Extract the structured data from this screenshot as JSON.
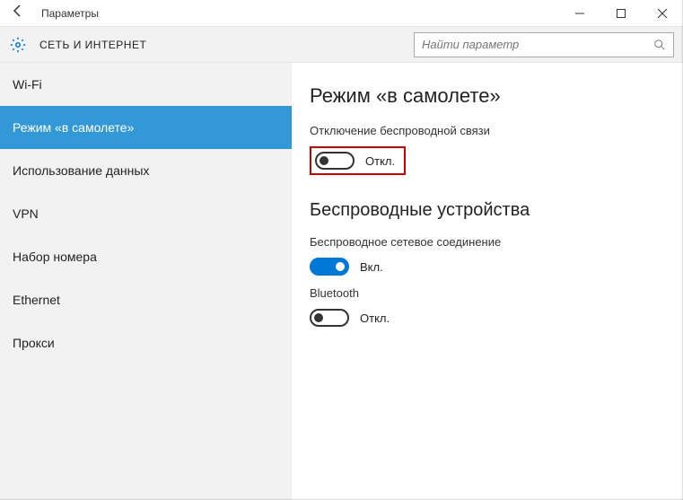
{
  "titlebar": {
    "title": "Параметры"
  },
  "header": {
    "title": "СЕТЬ И ИНТЕРНЕТ",
    "search_placeholder": "Найти параметр"
  },
  "sidebar": {
    "items": [
      {
        "label": "Wi-Fi"
      },
      {
        "label": "Режим «в самолете»"
      },
      {
        "label": "Использование данных"
      },
      {
        "label": "VPN"
      },
      {
        "label": "Набор номера"
      },
      {
        "label": "Ethernet"
      },
      {
        "label": "Прокси"
      }
    ],
    "active_index": 1
  },
  "main": {
    "h1": "Режим «в самолете»",
    "desc": "Отключение беспроводной связи",
    "airplane_toggle_label": "Откл.",
    "h2": "Беспроводные устройства",
    "wireless_label": "Беспроводное сетевое соединение",
    "wireless_toggle_label": "Вкл.",
    "bluetooth_label": "Bluetooth",
    "bluetooth_toggle_label": "Откл."
  },
  "colors": {
    "accent": "#0078d7",
    "highlight": "#c00",
    "selection": "#3399d6"
  }
}
